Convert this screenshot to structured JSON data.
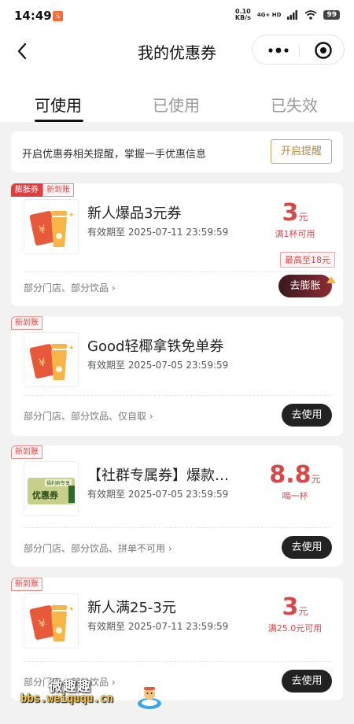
{
  "status_bar": {
    "time": "14:49",
    "app_badge": "S",
    "net_speed_value": "0.10",
    "net_speed_unit": "KB/s",
    "signal": "4G+ HD",
    "battery": "99"
  },
  "nav": {
    "title": "我的优惠券"
  },
  "tabs": [
    {
      "label": "可使用"
    },
    {
      "label": "已使用"
    },
    {
      "label": "已失效"
    }
  ],
  "reminder": {
    "text": "开启优惠券相关提醒，掌握一手优惠信息",
    "button": "开启提醒"
  },
  "coupons": [
    {
      "tags": [
        "膨胀券",
        "新到账"
      ],
      "title": "新人爆品3元券",
      "validity": "有效期至 2025-07-11 23:59:59",
      "amount": "3",
      "unit": "元",
      "condition": "满1杯可用",
      "max_badge": "最高至18元",
      "scope": "部分门店、部分饮品 ›",
      "action": "去膨胀"
    },
    {
      "tags": [
        "新到账"
      ],
      "title": "Good轻椰拿铁免单券",
      "validity": "有效期至 2025-07-05 23:59:59",
      "scope": "部分门店、部分饮品、仅自取 ›",
      "action": "去使用"
    },
    {
      "tags": [
        "新到账"
      ],
      "title": "【社群专属券】爆款…",
      "validity": "有效期至 2025-07-05 23:59:59",
      "amount": "8.8",
      "unit": "元",
      "condition": "喝一杯",
      "thumb_label": "优惠券",
      "thumb_badge": "福利群专享",
      "scope": "部分门店、部分饮品、拼单不可用 ›",
      "action": "去使用"
    },
    {
      "tags": [
        "新到账"
      ],
      "title": "新人满25-3元",
      "validity": "有效期至 2025-07-11 23:59:59",
      "amount": "3",
      "unit": "元",
      "condition": "满25.0元可用",
      "scope": "部分门店、部分饮品 ›",
      "action": "去使用"
    }
  ],
  "watermark": {
    "cn": "微趣趣",
    "url": "bbs.weiququ.cn"
  },
  "colors": {
    "accent_red": "#d84848",
    "gold": "#b48a3c",
    "dark_button": "#222222"
  }
}
